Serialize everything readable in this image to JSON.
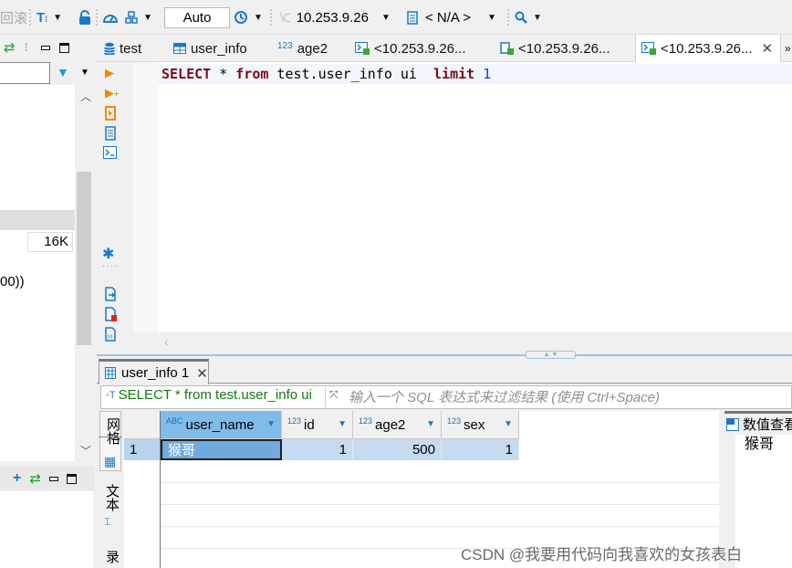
{
  "toolbar": {
    "cut_label": "回滚",
    "transaction_mode": "Auto",
    "connection": "10.253.9.26",
    "schema": "< N/A >",
    "icons": [
      "text-format-icon",
      "lock-icon",
      "dashboard-icon",
      "network-icon",
      "history-icon",
      "connection-icon",
      "schema-icon",
      "search-icon"
    ]
  },
  "left_panel": {
    "size_value": "16K",
    "ddl_snippet": "00))"
  },
  "editor": {
    "tabs": [
      {
        "label": "test",
        "icon": "database-icon"
      },
      {
        "label": "user_info",
        "icon": "table-icon"
      },
      {
        "label": "age2",
        "icon": "numeric-column-icon",
        "prefix": "123"
      },
      {
        "label": "<10.253.9.26...",
        "icon": "sql-console-icon"
      },
      {
        "label": "<10.253.9.26...",
        "icon": "sql-script-icon"
      },
      {
        "label": "<10.253.9.26...",
        "icon": "sql-console-icon",
        "active": true
      }
    ],
    "overflow_label": "»",
    "sql": {
      "kw1": "SELECT",
      "star": " * ",
      "kw2": "from",
      "mid": " test.user_info ui  ",
      "kw3": "limit",
      "sp": " ",
      "num": "1"
    }
  },
  "results": {
    "tab_label": "user_info 1",
    "filter_sql": "SELECT * from test.user_info ui",
    "filter_placeholder": "输入一个 SQL 表达式来过滤结果 (使用 Ctrl+Space)",
    "side_tabs": [
      "网格",
      "文本",
      "记录"
    ],
    "columns": [
      {
        "name": "user_name",
        "type": "ABC"
      },
      {
        "name": "id",
        "type": "123"
      },
      {
        "name": "age2",
        "type": "123"
      },
      {
        "name": "sex",
        "type": "123"
      }
    ],
    "rows": [
      {
        "index": "1",
        "user_name": "猴哥",
        "id": "1",
        "age2": "500",
        "sex": "1"
      }
    ],
    "value_viewer": {
      "title": "数值查看",
      "value": "猴哥"
    }
  },
  "watermark": "CSDN @我要用代码向我喜欢的女孩表白"
}
